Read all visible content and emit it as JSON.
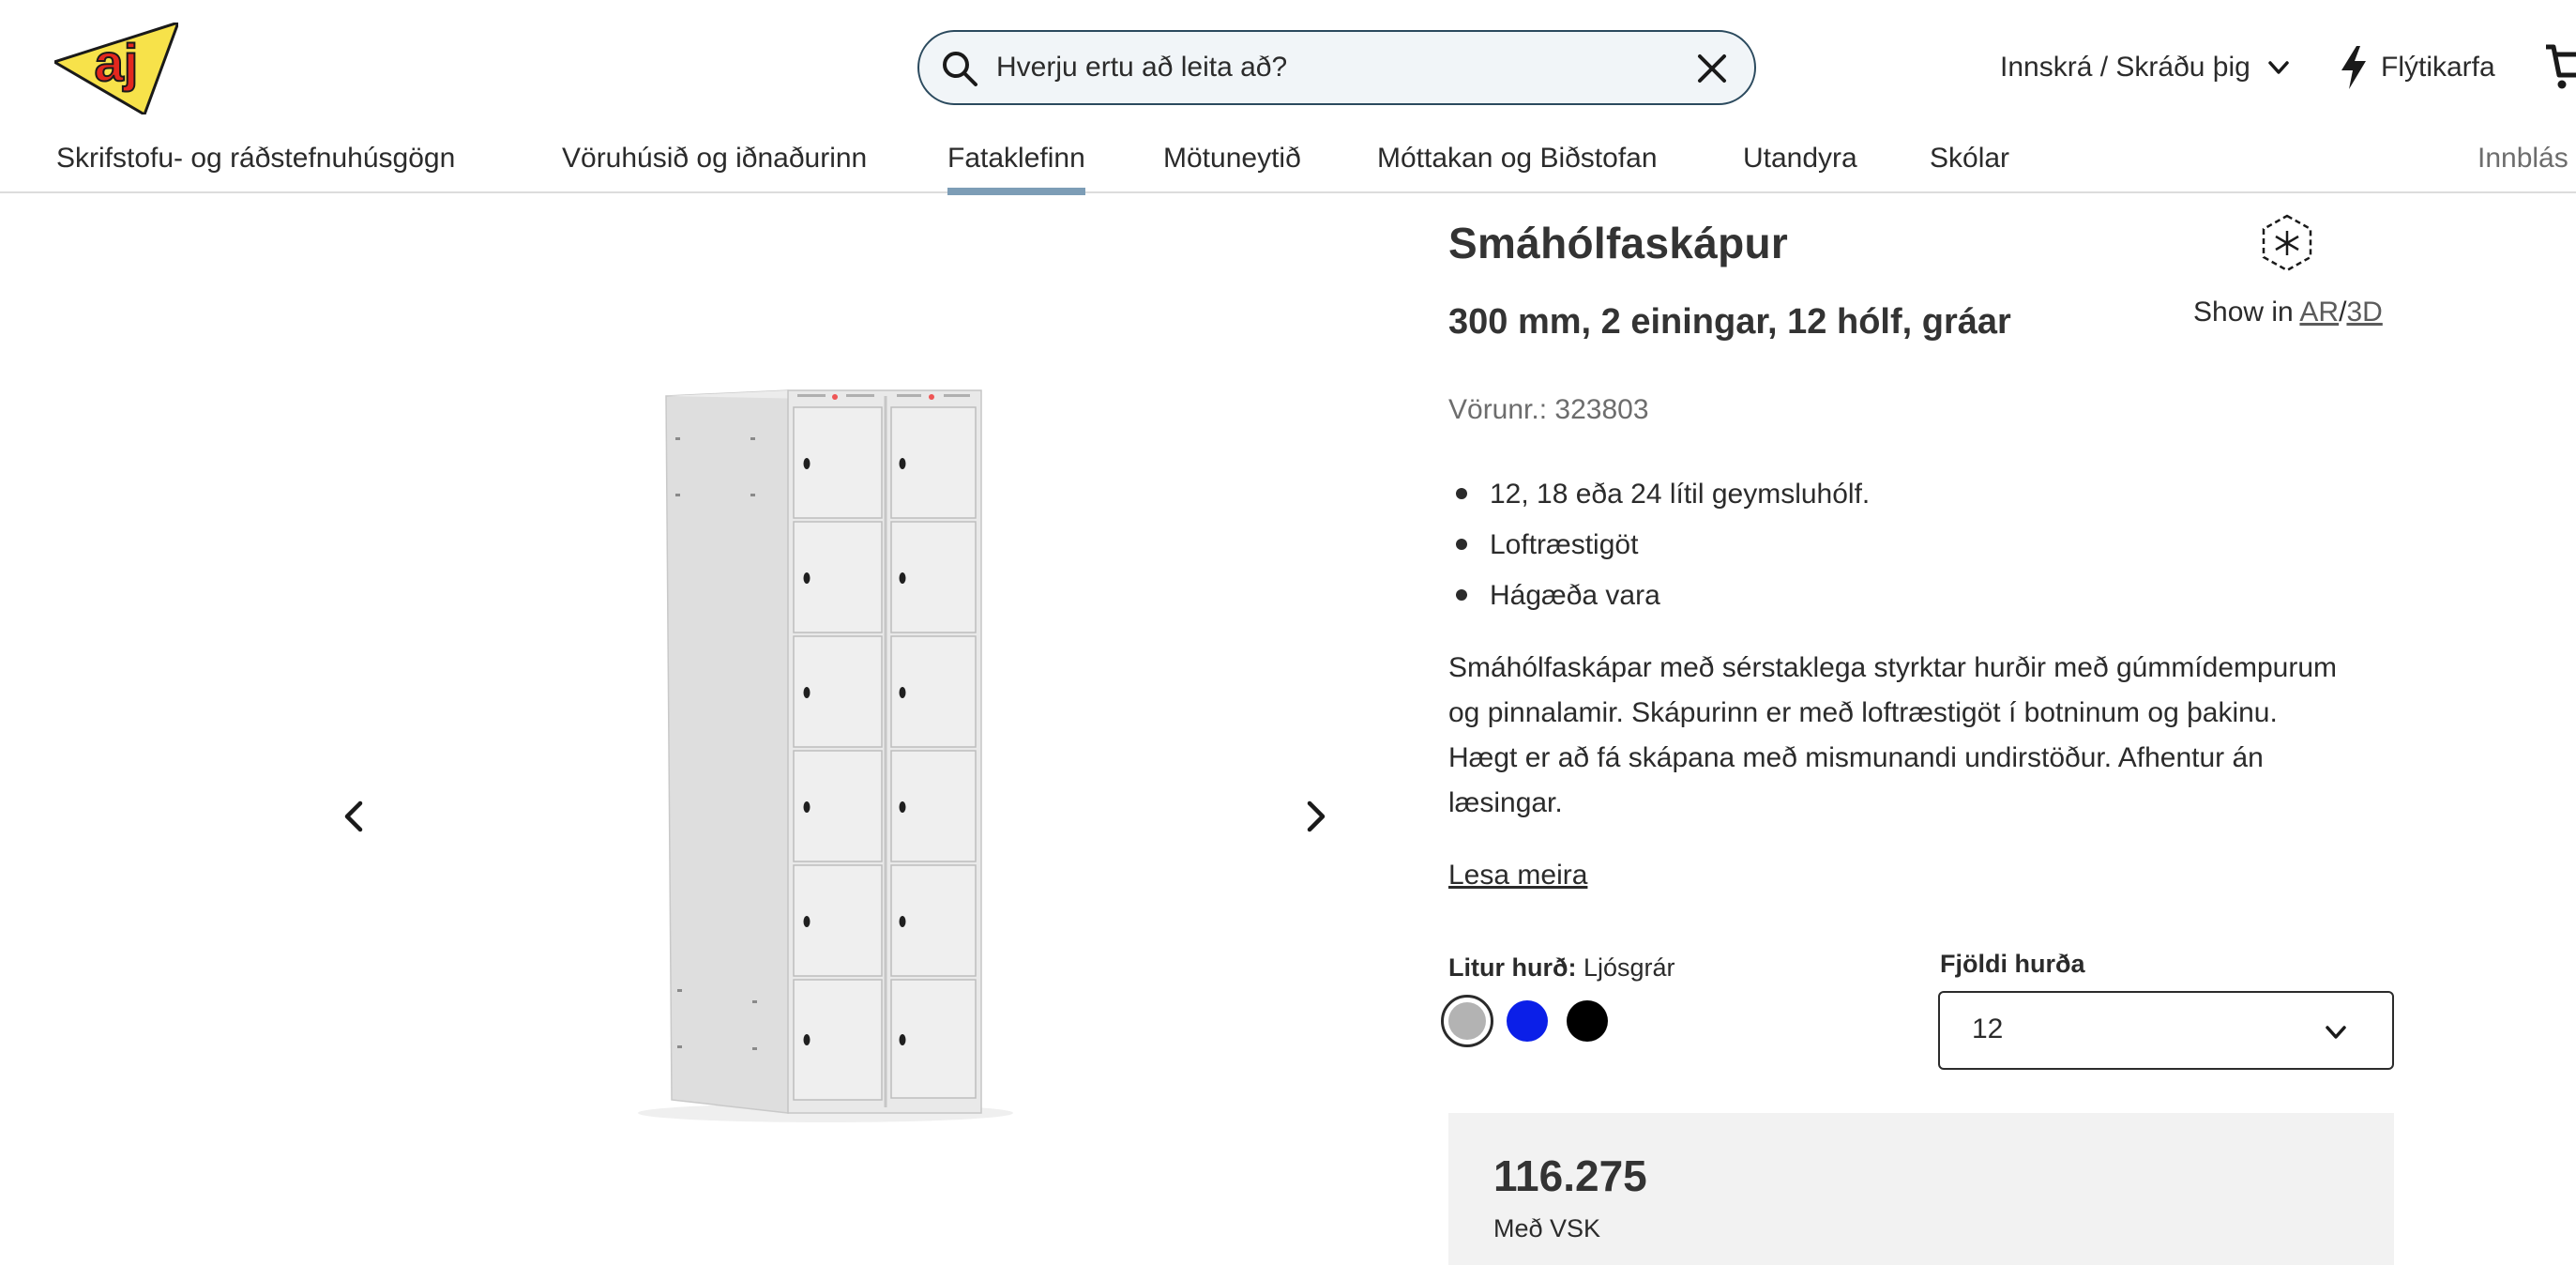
{
  "header": {
    "search": {
      "placeholder": "Hverju ertu að leita að?",
      "value": ""
    },
    "login_label": "Innskrá / Skráðu þig",
    "quick_cart_label": "Flýtikarfa",
    "icons": [
      "aj-logo",
      "search-icon",
      "close-icon",
      "chevron-down-icon",
      "lightning-icon",
      "cart-icon"
    ]
  },
  "nav": {
    "items": [
      {
        "label": "Skrifstofu- og ráðstefnuhúsgögn",
        "active": false
      },
      {
        "label": "Vöruhúsið og iðnaðurinn",
        "active": false
      },
      {
        "label": "Fataklefinn",
        "active": true
      },
      {
        "label": "Mötuneytið",
        "active": false
      },
      {
        "label": "Móttakan og Biðstofan",
        "active": false
      },
      {
        "label": "Utandyra",
        "active": false
      },
      {
        "label": "Skólar",
        "active": false
      },
      {
        "label": "Innblás",
        "active": false
      }
    ]
  },
  "product": {
    "title": "Smáhólfaskápur",
    "subtitle": "300 mm, 2 einingar, 12 hólf, gráar",
    "show_in_prefix": "Show in",
    "show_in_ar": "AR",
    "show_in_sep": "/",
    "show_in_3d": "3D",
    "article_number": "Vörunr.: 323803",
    "bullets": [
      "12, 18 eða 24 lítil geymsluhólf.",
      "Loftræstigöt",
      "Hágæða vara"
    ],
    "description": "Smáhólfaskápar með sérstaklega styrktar hurðir með gúmmídempurum og pinnalamir. Skápurinn er með loftræstigöt í botninum og þakinu. Hægt er að fá skápana með mismunandi undirstöður. Afhentur án læsingar.",
    "read_more": "Lesa meira",
    "color": {
      "label": "Litur hurð:",
      "selected": "Ljósgrár",
      "swatches": [
        {
          "name": "Ljósgrár",
          "hex": "#b3b3b3",
          "selected": true
        },
        {
          "name": "blue",
          "hex": "#0b1fe8",
          "selected": false
        },
        {
          "name": "black",
          "hex": "#000000",
          "selected": false
        }
      ]
    },
    "door_count": {
      "label": "Fjöldi hurða",
      "selected": "12"
    },
    "price": "116.275",
    "vat_label": "Með VSK"
  }
}
